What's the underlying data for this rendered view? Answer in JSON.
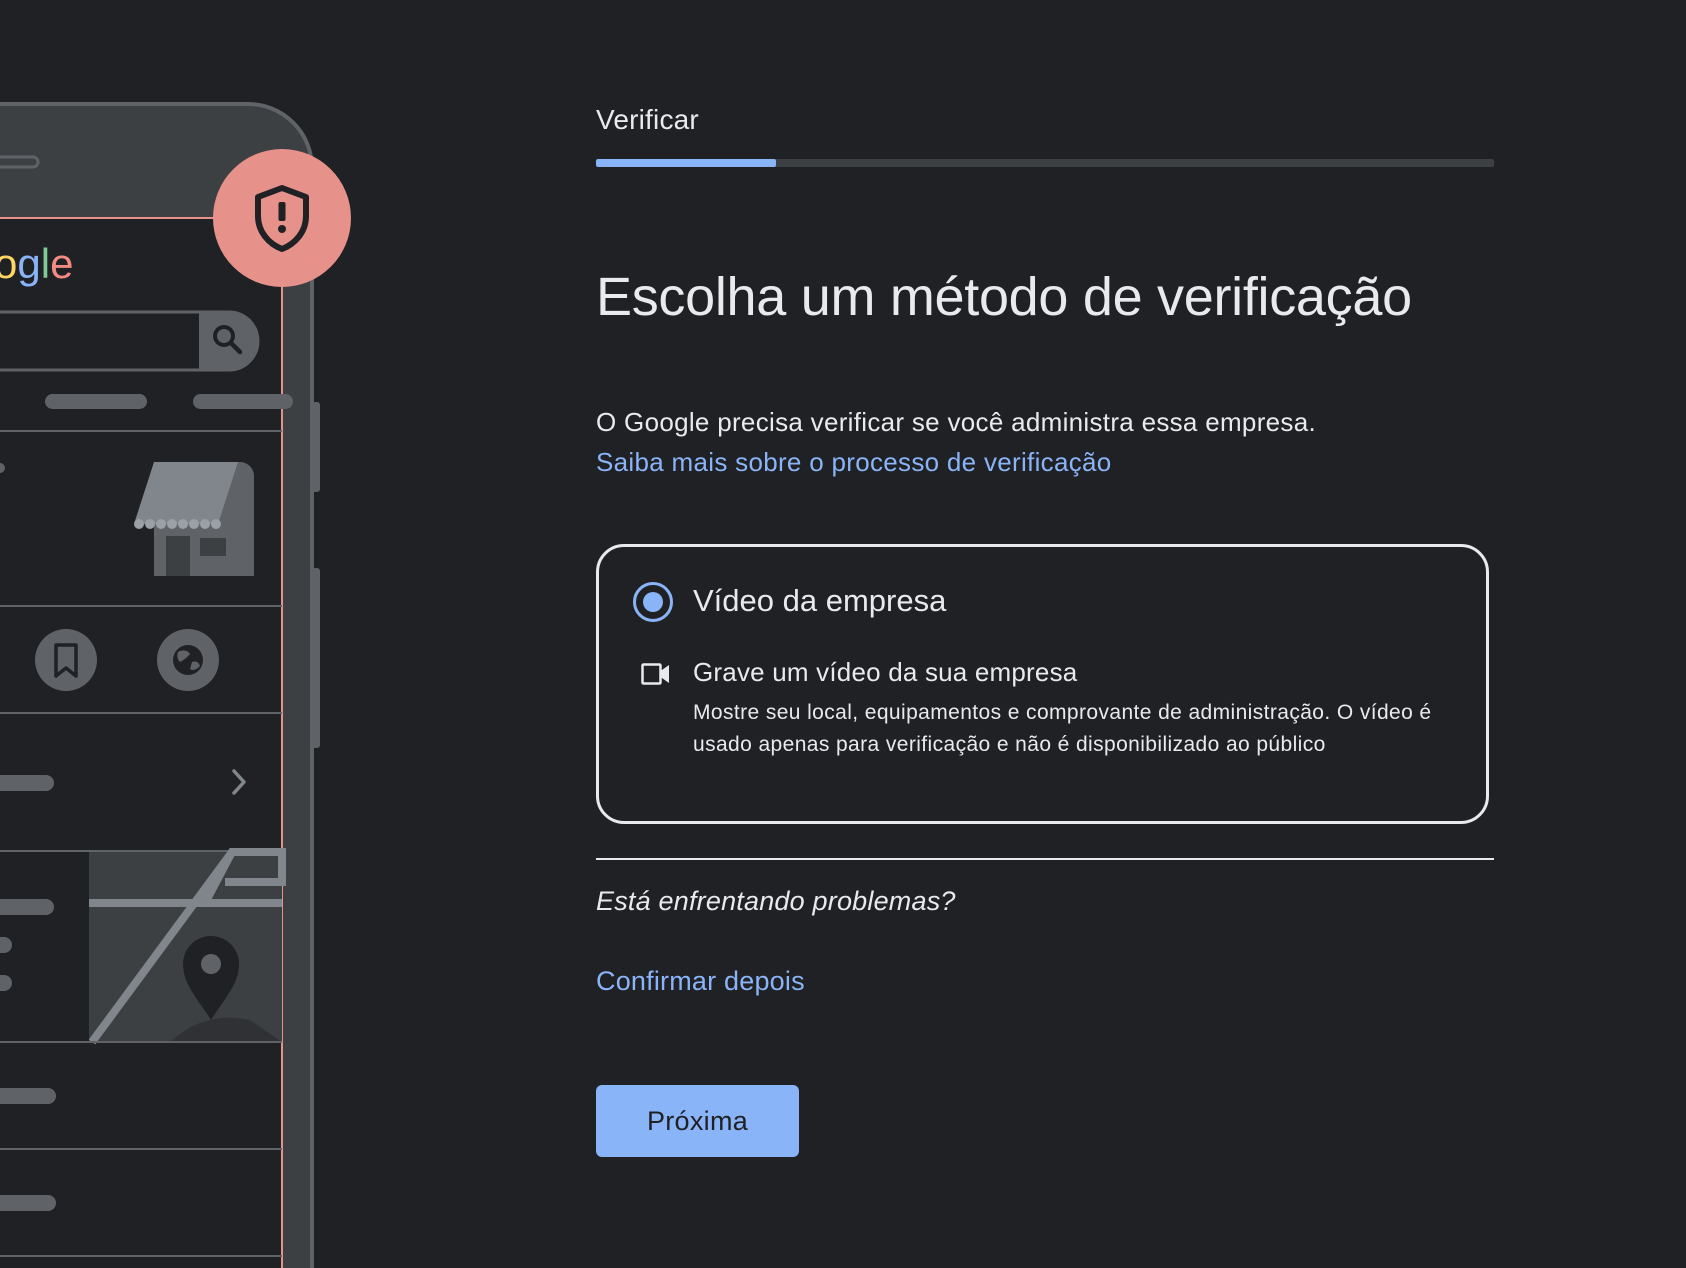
{
  "illustration": {
    "logo_fragment": "ogle",
    "icons": [
      "shield-alert-icon",
      "search-icon",
      "bookmark-icon",
      "globe-icon",
      "chevron-right-icon",
      "map-pin-icon",
      "storefront-icon"
    ],
    "colors": {
      "badge": "#e6918a",
      "screen_border": "#e6918a",
      "logo_yellow": "#fdd663",
      "logo_green": "#81c995",
      "logo_blue": "#8ab4f8",
      "logo_red": "#f28b82"
    }
  },
  "header": {
    "step_label": "Verificar",
    "progress": 0.2
  },
  "main": {
    "title": "Escolha um método de verificação",
    "description": "O Google precisa verificar se você administra essa empresa.",
    "learn_more_link": "Saiba mais sobre o processo de verificação"
  },
  "option": {
    "selected": true,
    "title": "Vídeo da empresa",
    "icon": "videocam-icon",
    "subtitle": "Grave um vídeo da sua empresa",
    "description": "Mostre seu local, equipamentos e comprovante de administração. O vídeo é usado apenas para verificação e não é disponibilizado ao público"
  },
  "footer": {
    "trouble_text": "Está enfrentando problemas?",
    "confirm_later_link": "Confirmar depois",
    "next_button": "Próxima"
  },
  "colors": {
    "background": "#202124",
    "text": "#e8eaed",
    "accent": "#8ab4f8",
    "track": "#3c4043"
  }
}
